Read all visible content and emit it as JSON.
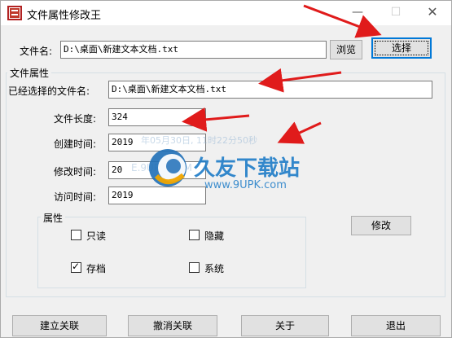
{
  "window": {
    "title": "文件属性修改王",
    "min_glyph": "—",
    "max_glyph": "☐",
    "close_glyph": "✕"
  },
  "file_row": {
    "label": "文件名:",
    "value": "D:\\桌面\\新建文本文档.txt",
    "browse_label": "浏览",
    "select_label": "选择"
  },
  "props": {
    "group_title": "文件属性",
    "selected_label": "已经选择的文件名:",
    "selected_value": "D:\\桌面\\新建文本文档.txt",
    "length_label": "文件长度:",
    "length_value": "324",
    "created_label": "创建时间:",
    "created_value": "2019",
    "modified_label": "修改时间:",
    "modified_value": "20",
    "accessed_label": "访问时间:",
    "accessed_value": "2019"
  },
  "attributes": {
    "title": "属性",
    "readonly_label": "只读",
    "readonly_checked": false,
    "hidden_label": "隐藏",
    "hidden_checked": false,
    "archive_label": "存档",
    "archive_checked": true,
    "system_label": "系统",
    "system_checked": false,
    "modify_label": "修改"
  },
  "bottom_buttons": {
    "associate_label": "建立关联",
    "unassociate_label": "撤消关联",
    "about_label": "关于",
    "exit_label": "退出"
  },
  "watermark": {
    "brand": "久友下载站",
    "url": "www.9UPK.com",
    "faint_1": "年05月30日, 11时22分50秒",
    "faint_2": "E.9UPK.COM"
  },
  "colors": {
    "arrow": "#e01b1b",
    "focus": "#0078d7"
  }
}
